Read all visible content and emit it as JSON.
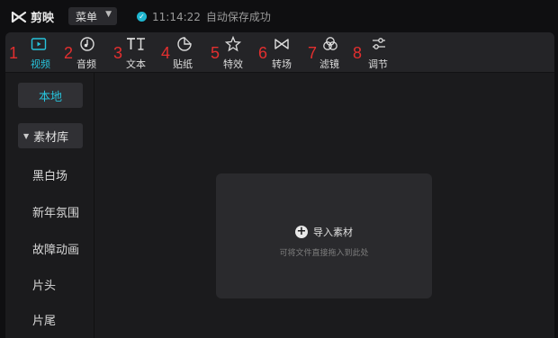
{
  "app": {
    "name": "剪映"
  },
  "topbar": {
    "menu_label": "菜单",
    "save_time": "11:14:22",
    "save_text": "自动保存成功"
  },
  "toolbar": {
    "items": [
      {
        "num": "1",
        "label": "视频",
        "icon": "video-icon",
        "active": true
      },
      {
        "num": "2",
        "label": "音频",
        "icon": "audio-icon"
      },
      {
        "num": "3",
        "label": "文本",
        "icon": "text-icon"
      },
      {
        "num": "4",
        "label": "贴纸",
        "icon": "sticker-icon"
      },
      {
        "num": "5",
        "label": "特效",
        "icon": "effects-icon"
      },
      {
        "num": "6",
        "label": "转场",
        "icon": "transition-icon"
      },
      {
        "num": "7",
        "label": "滤镜",
        "icon": "filter-icon"
      },
      {
        "num": "8",
        "label": "调节",
        "icon": "adjust-icon"
      }
    ],
    "accent_color": "#27c3dc",
    "number_color": "#e32f2f"
  },
  "sidebar": {
    "local": "本地",
    "library": "素材库",
    "items": [
      "黑白场",
      "新年氛围",
      "故障动画",
      "片头",
      "片尾"
    ]
  },
  "dropzone": {
    "import_label": "导入素材",
    "hint": "可将文件直接拖入到此处"
  }
}
